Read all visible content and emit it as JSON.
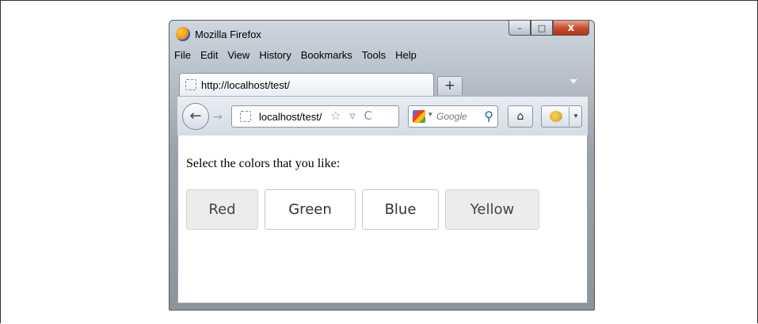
{
  "window": {
    "title": "Mozilla Firefox",
    "controls": {
      "minimize": "–",
      "maximize": "□",
      "close": "x"
    }
  },
  "menubar": [
    "File",
    "Edit",
    "View",
    "History",
    "Bookmarks",
    "Tools",
    "Help"
  ],
  "tab": {
    "label": "http://localhost/test/",
    "new_tab": "+"
  },
  "navbar": {
    "back": "←",
    "forward": "→",
    "url": "localhost/test/",
    "url_icons": "☆ ▿ C",
    "search_placeholder": "Google",
    "search_go": "⚲",
    "home": "⌂",
    "addon_caret": "▾"
  },
  "page": {
    "prompt": "Select the colors that you like:",
    "buttons": [
      {
        "label": "Red",
        "selected": false
      },
      {
        "label": "Green",
        "selected": true
      },
      {
        "label": "Blue",
        "selected": true
      },
      {
        "label": "Yellow",
        "selected": false
      }
    ]
  }
}
